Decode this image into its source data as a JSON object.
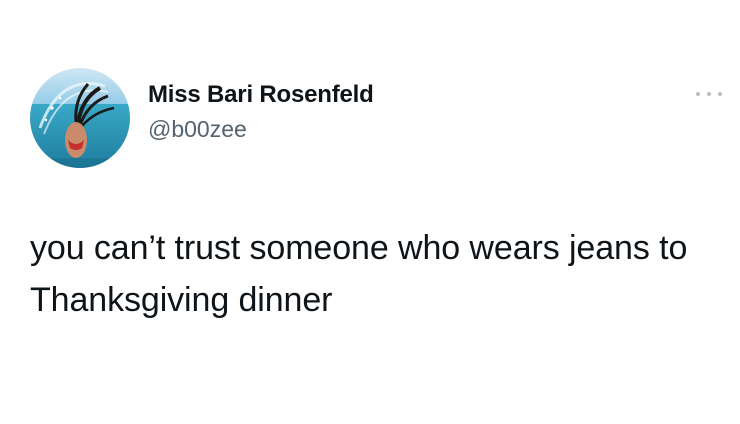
{
  "tweet": {
    "author": {
      "display_name": "Miss Bari Rosenfeld",
      "handle": "@b00zee",
      "avatar_icon": "profile-photo-hair-flip-pool"
    },
    "menu_icon": "more-options-icon",
    "text": "you can’t trust someone who wears jeans to Thanksgiving dinner"
  }
}
